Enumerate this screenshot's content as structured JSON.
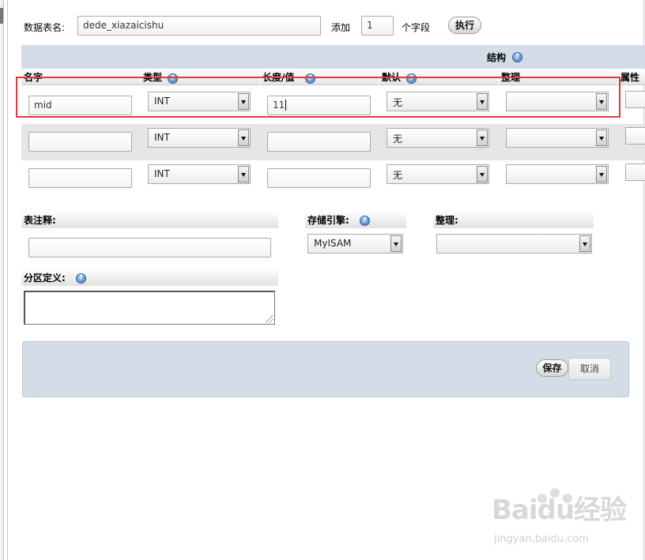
{
  "table_name": {
    "label": "数据表名:",
    "value": "dede_xiazaicishu"
  },
  "add_fields": {
    "label": "添加",
    "count": "1",
    "unit": "个字段",
    "execute_label": "执行"
  },
  "structure": {
    "title": "结构",
    "columns": {
      "name": "名字",
      "type": "类型",
      "length": "长度/值",
      "default": "默认",
      "collation": "整理",
      "attributes": "属性"
    },
    "rows": [
      {
        "name": "mid",
        "type": "INT",
        "length": "11",
        "default": "无",
        "collation": ""
      },
      {
        "name": "",
        "type": "INT",
        "length": "",
        "default": "无",
        "collation": ""
      },
      {
        "name": "",
        "type": "INT",
        "length": "",
        "default": "无",
        "collation": ""
      }
    ]
  },
  "table_comment": {
    "label": "表注释:",
    "value": ""
  },
  "storage_engine": {
    "label": "存储引擎:",
    "value": "MyISAM"
  },
  "table_collation": {
    "label": "整理:",
    "value": ""
  },
  "partition": {
    "label": "分区定义:",
    "value": ""
  },
  "footer": {
    "save_label": "保存",
    "cancel_label": "取消"
  },
  "watermark": {
    "brand": "Baidu经验",
    "url": "jingyan.baidu.com"
  },
  "colors": {
    "header_bar": "#d4dde7",
    "highlight": "#e0383b",
    "help_icon": "#3f78c2"
  }
}
